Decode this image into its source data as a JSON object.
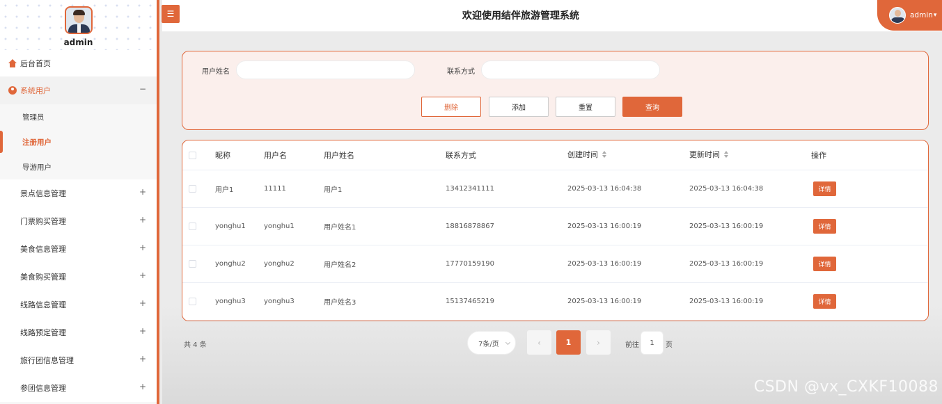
{
  "sidebar": {
    "username": "admin",
    "home": "后台首页",
    "system_users": "系统用户",
    "sub_items": [
      "管理员",
      "注册用户",
      "导游用户"
    ],
    "menu_items": [
      "景点信息管理",
      "门票购买管理",
      "美食信息管理",
      "美食购买管理",
      "线路信息管理",
      "线路预定管理",
      "旅行团信息管理",
      "参团信息管理"
    ],
    "expanded_sign": "−",
    "collapsed_sign": "+"
  },
  "header": {
    "toggle_icon": "☰",
    "title": "欢迎使用结伴旅游管理系统",
    "user": "admin",
    "user_caret": "▾"
  },
  "search": {
    "field1_label": "用户姓名",
    "field2_label": "联系方式",
    "field1_value": "",
    "field2_value": "",
    "delete": "删除",
    "add": "添加",
    "reset": "重置",
    "query": "查询"
  },
  "table": {
    "columns": [
      "昵称",
      "用户名",
      "用户姓名",
      "联系方式",
      "创建时间",
      "更新时间",
      "操作"
    ],
    "rows": [
      {
        "nickname": "用户1",
        "username": "11111",
        "realname": "用户1",
        "phone": "13412341111",
        "created": "2025-03-13 16:04:38",
        "updated": "2025-03-13 16:04:38"
      },
      {
        "nickname": "yonghu1",
        "username": "yonghu1",
        "realname": "用户姓名1",
        "phone": "18816878867",
        "created": "2025-03-13 16:00:19",
        "updated": "2025-03-13 16:00:19"
      },
      {
        "nickname": "yonghu2",
        "username": "yonghu2",
        "realname": "用户姓名2",
        "phone": "17770159190",
        "created": "2025-03-13 16:00:19",
        "updated": "2025-03-13 16:00:19"
      },
      {
        "nickname": "yonghu3",
        "username": "yonghu3",
        "realname": "用户姓名3",
        "phone": "15137465219",
        "created": "2025-03-13 16:00:19",
        "updated": "2025-03-13 16:00:19"
      }
    ],
    "detail_label": "详情"
  },
  "pagination": {
    "total": "共 4 条",
    "page_size": "7条/页",
    "prev": "‹",
    "current": "1",
    "next": "›",
    "goto_label": "前往",
    "goto_value": "1",
    "page_unit": "页"
  },
  "watermark": "CSDN @vx_CXKF10088",
  "colors": {
    "accent": "#e0673a",
    "panel_bg": "#fbefec"
  }
}
